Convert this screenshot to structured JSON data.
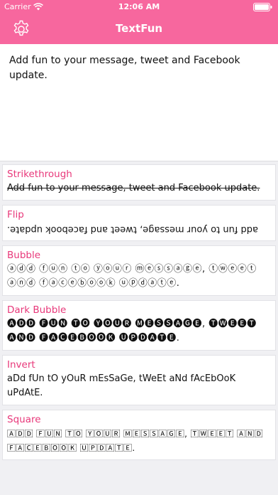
{
  "status_bar": {
    "carrier": "Carrier",
    "time": "12:06 AM",
    "wifi_icon": "wifi-icon",
    "battery_icon": "battery-icon"
  },
  "nav": {
    "title": "TextFun",
    "settings_icon": "gear-icon"
  },
  "colors": {
    "accent": "#f7679e",
    "card_title": "#e8387a",
    "background": "#f0f0f3"
  },
  "input": {
    "value": "Add fun to your message, tweet and Facebook update."
  },
  "styles": [
    {
      "title": "Strikethrough",
      "text": "Add fun to your message, tweet and Facebook update."
    },
    {
      "title": "Flip",
      "text": "add fun to your message, tweet and facebook update."
    },
    {
      "title": "Bubble",
      "text": "ⓐⓓⓓ ⓕⓤⓝ ⓣⓞ ⓨⓞⓤⓡ ⓜⓔⓢⓢⓐⓖⓔ, ⓣⓦⓔⓔⓣ ⓐⓝⓓ ⓕⓐⓒⓔⓑⓞⓞⓚ ⓤⓟⓓⓐⓣⓔ."
    },
    {
      "title": "Dark Bubble",
      "text": "🅐🅓🅓 🅕🅤🅝 🅣🅞 🅨🅞🅤🅡 🅜🅔🅢🅢🅐🅖🅔, 🅣🅦🅔🅔🅣 🅐🅝🅓 🅕🅐🅒🅔🅑🅞🅞🅚 🅤🅟🅓🅐🅣🅔."
    },
    {
      "title": "Invert",
      "text": "aDd fUn tO yOuR mEsSaGe, tWeEt aNd fAcEbOoK uPdAtE."
    },
    {
      "title": "Square",
      "text": "🄰🄳🄳 🄵🅄🄽 🅃🄾 🅈🄾🅄🅁 🄼🄴🅂🅂🄰🄶🄴, 🅃🅆🄴🄴🅃 🄰🄽🄳 🄵🄰🄲🄴🄱🄾🄾🄺 🅄🄿🄳🄰🅃🄴."
    }
  ]
}
